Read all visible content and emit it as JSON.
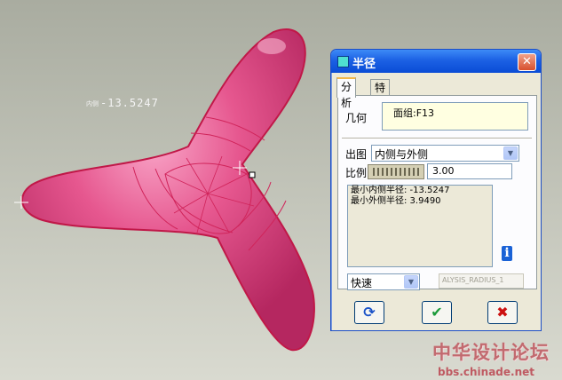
{
  "viewport": {
    "annotation_prefix": "内侧",
    "annotation_value": "-13.5247"
  },
  "dialog": {
    "title": "半径",
    "close_glyph": "✕",
    "tabs": [
      "分析",
      "特征"
    ],
    "geometry_label": "几何",
    "geometry_value": "面组:F13",
    "output_label": "出图",
    "output_value": "内侧与外侧",
    "scale_label": "比例",
    "scale_value": "3.00",
    "results": [
      "最小内侧半径: -13.5247",
      "最小外侧半径: 3.9490"
    ],
    "info_glyph": "i",
    "mode_value": "快速",
    "analysis_name": "ALYSIS_RADIUS_1",
    "buttons": {
      "repeat_glyph": "⟳",
      "ok_glyph": "✔",
      "cancel_glyph": "✖"
    },
    "colors": {
      "ok": "#1b9a3a",
      "cancel": "#cc1111",
      "repeat": "#1a52c8"
    }
  },
  "watermark": {
    "name": "中华设计论坛",
    "url": "bbs.chinade.net"
  }
}
